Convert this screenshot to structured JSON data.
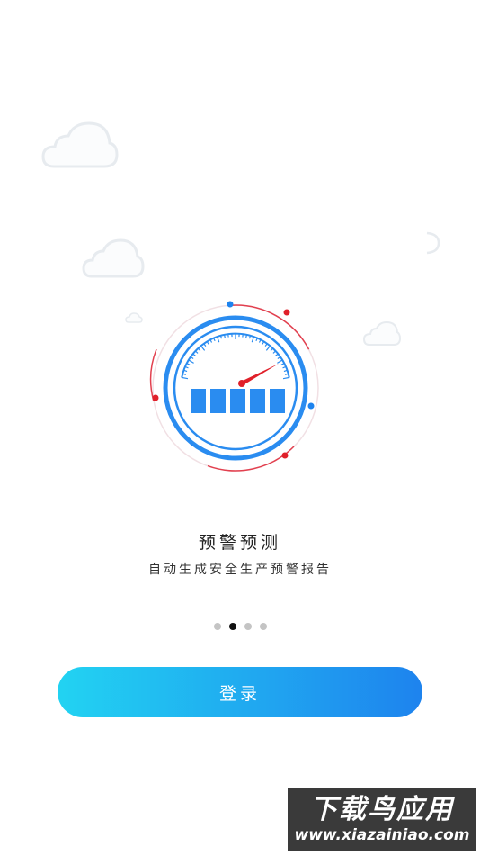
{
  "slide": {
    "title": "预警预测",
    "subtitle": "自动生成安全生产预警报告",
    "illustration": "gauge-illustration",
    "pager": {
      "count": 4,
      "current_index": 1
    }
  },
  "login_button": {
    "label": "登录"
  },
  "watermark": {
    "main": "下载鸟应用",
    "url": "www.xiazainiao.com"
  },
  "colors": {
    "accent_blue": "#1e83ee",
    "gradient_start": "#22d3f2",
    "gradient_end": "#1e83ee",
    "needle_red": "#e0202a",
    "cloud_gray": "#eef1f4"
  },
  "icons": [
    "cloud-icon",
    "gauge-icon",
    "needle-icon"
  ]
}
